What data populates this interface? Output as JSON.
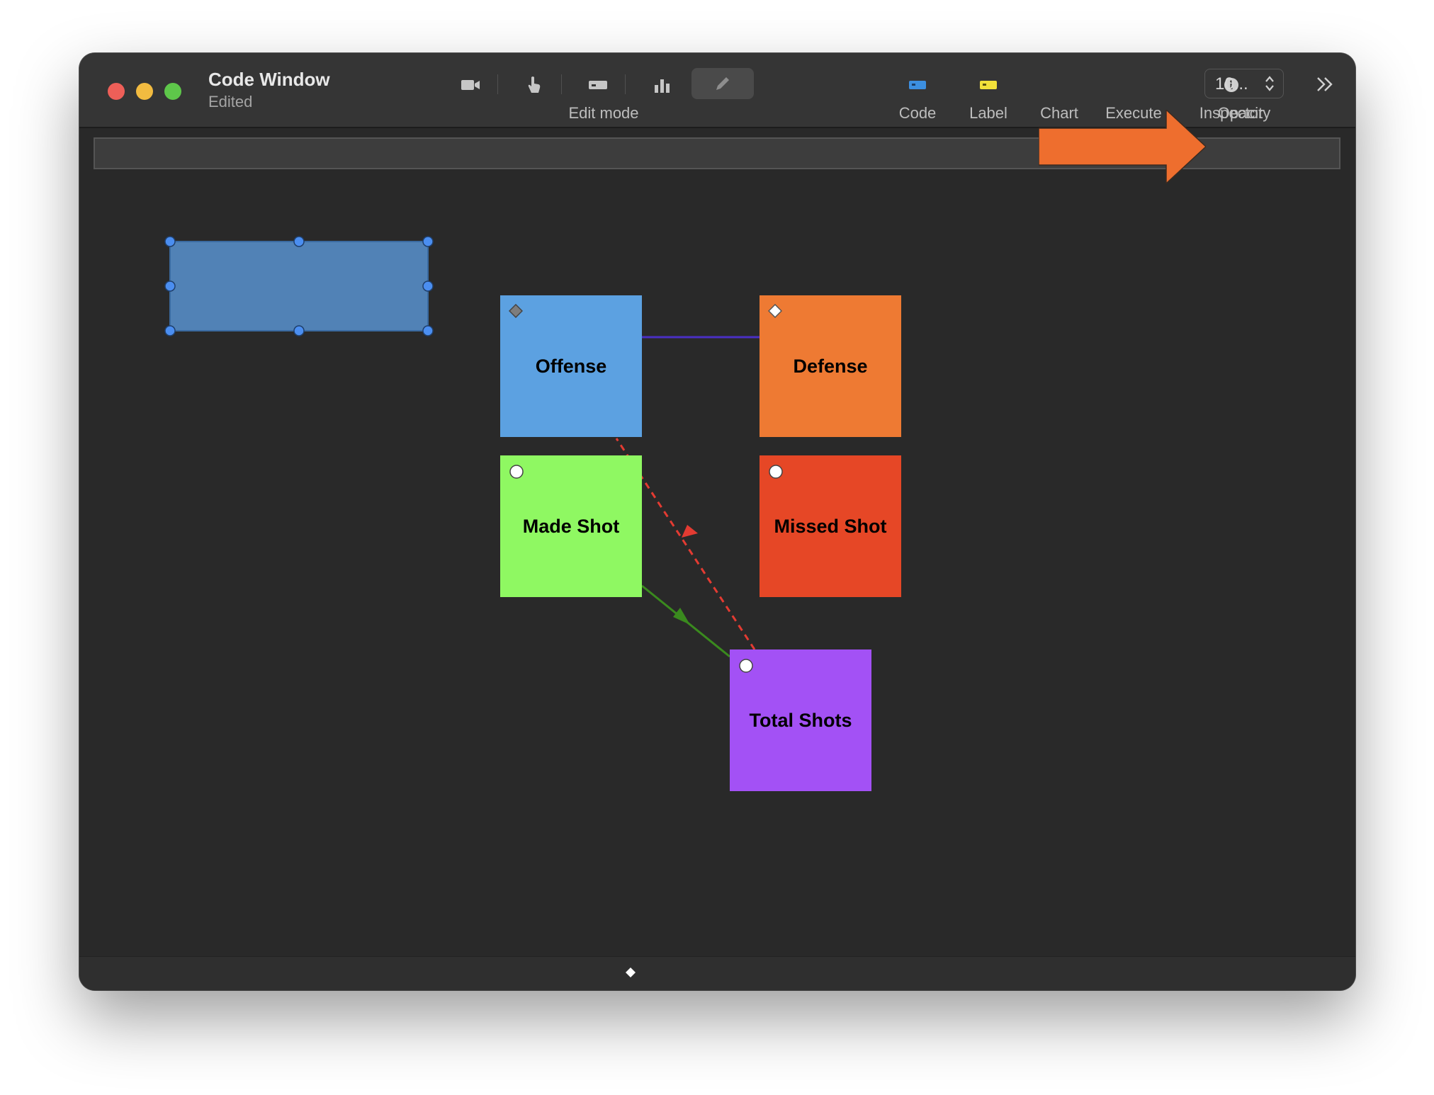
{
  "window": {
    "title": "Code Window",
    "subtitle": "Edited"
  },
  "toolbar": {
    "edit_mode_label": "Edit mode",
    "code_label": "Code",
    "label_label": "Label",
    "chart_label": "Chart",
    "execute_label": "Execute",
    "inspector_label": "Inspector",
    "opacity_label": "Opacity",
    "opacity_value": "10..."
  },
  "tools": [
    {
      "icon": "video-camera-icon"
    },
    {
      "icon": "hand-pointer-icon"
    },
    {
      "icon": "rectangle-icon"
    },
    {
      "icon": "bar-chart-icon"
    },
    {
      "icon": "pencil-icon",
      "selected": true
    }
  ],
  "canvas": {
    "nodes": [
      {
        "label": "Offense",
        "color": "#5ca1e1",
        "marker": "diamond-filled"
      },
      {
        "label": "Defense",
        "color": "#ee7a33",
        "marker": "diamond-outline"
      },
      {
        "label": "Made Shot",
        "color": "#8ff862",
        "marker": "circle"
      },
      {
        "label": "Missed Shot",
        "color": "#e64726",
        "marker": "circle"
      },
      {
        "label": "Total Shots",
        "color": "#a351f5",
        "marker": "circle"
      }
    ],
    "connections": [
      {
        "from": "Offense",
        "to": "Defense",
        "style": "solid",
        "color": "#4a2fc4"
      },
      {
        "from": "Made Shot",
        "to": "Total Shots",
        "style": "solid-arrow",
        "color": "#3a8a1e"
      },
      {
        "from": "Total Shots",
        "to": "Offense",
        "style": "dashed-arrow",
        "color": "#e33b32"
      }
    ],
    "selected_shape_color": "#5182b6"
  },
  "annotation": {
    "arrow_color": "#ee6e2e"
  }
}
